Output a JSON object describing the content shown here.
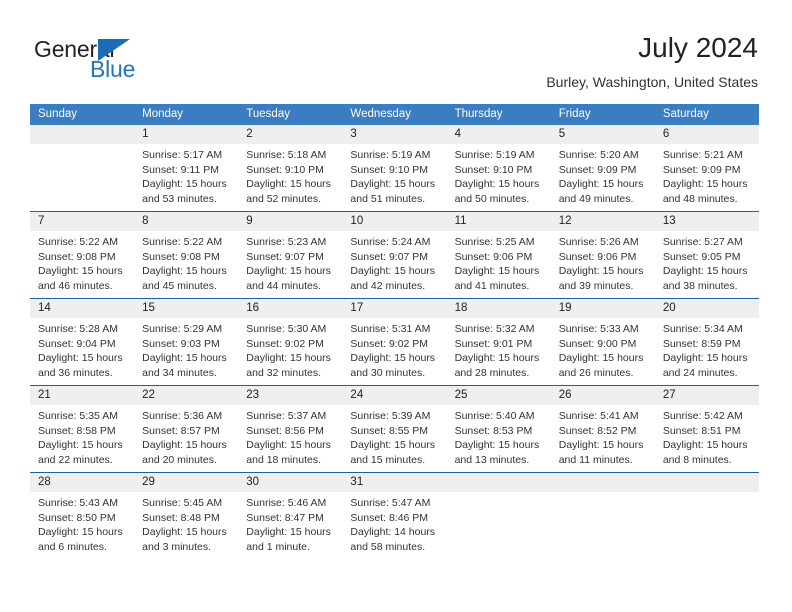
{
  "brand": {
    "name_top": "General",
    "name_bottom": "Blue",
    "accent_color": "#1b6cb5"
  },
  "header": {
    "title": "July 2024",
    "location": "Burley, Washington, United States"
  },
  "calendar": {
    "header_bg": "#3a7dc0",
    "row_border_color": "#1f5fa8",
    "daynum_bg": "#efefef",
    "weekdays": [
      "Sunday",
      "Monday",
      "Tuesday",
      "Wednesday",
      "Thursday",
      "Friday",
      "Saturday"
    ],
    "weeks": [
      [
        {
          "day": "",
          "lines": []
        },
        {
          "day": "1",
          "lines": [
            "Sunrise: 5:17 AM",
            "Sunset: 9:11 PM",
            "Daylight: 15 hours",
            "and 53 minutes."
          ]
        },
        {
          "day": "2",
          "lines": [
            "Sunrise: 5:18 AM",
            "Sunset: 9:10 PM",
            "Daylight: 15 hours",
            "and 52 minutes."
          ]
        },
        {
          "day": "3",
          "lines": [
            "Sunrise: 5:19 AM",
            "Sunset: 9:10 PM",
            "Daylight: 15 hours",
            "and 51 minutes."
          ]
        },
        {
          "day": "4",
          "lines": [
            "Sunrise: 5:19 AM",
            "Sunset: 9:10 PM",
            "Daylight: 15 hours",
            "and 50 minutes."
          ]
        },
        {
          "day": "5",
          "lines": [
            "Sunrise: 5:20 AM",
            "Sunset: 9:09 PM",
            "Daylight: 15 hours",
            "and 49 minutes."
          ]
        },
        {
          "day": "6",
          "lines": [
            "Sunrise: 5:21 AM",
            "Sunset: 9:09 PM",
            "Daylight: 15 hours",
            "and 48 minutes."
          ]
        }
      ],
      [
        {
          "day": "7",
          "lines": [
            "Sunrise: 5:22 AM",
            "Sunset: 9:08 PM",
            "Daylight: 15 hours",
            "and 46 minutes."
          ]
        },
        {
          "day": "8",
          "lines": [
            "Sunrise: 5:22 AM",
            "Sunset: 9:08 PM",
            "Daylight: 15 hours",
            "and 45 minutes."
          ]
        },
        {
          "day": "9",
          "lines": [
            "Sunrise: 5:23 AM",
            "Sunset: 9:07 PM",
            "Daylight: 15 hours",
            "and 44 minutes."
          ]
        },
        {
          "day": "10",
          "lines": [
            "Sunrise: 5:24 AM",
            "Sunset: 9:07 PM",
            "Daylight: 15 hours",
            "and 42 minutes."
          ]
        },
        {
          "day": "11",
          "lines": [
            "Sunrise: 5:25 AM",
            "Sunset: 9:06 PM",
            "Daylight: 15 hours",
            "and 41 minutes."
          ]
        },
        {
          "day": "12",
          "lines": [
            "Sunrise: 5:26 AM",
            "Sunset: 9:06 PM",
            "Daylight: 15 hours",
            "and 39 minutes."
          ]
        },
        {
          "day": "13",
          "lines": [
            "Sunrise: 5:27 AM",
            "Sunset: 9:05 PM",
            "Daylight: 15 hours",
            "and 38 minutes."
          ]
        }
      ],
      [
        {
          "day": "14",
          "lines": [
            "Sunrise: 5:28 AM",
            "Sunset: 9:04 PM",
            "Daylight: 15 hours",
            "and 36 minutes."
          ]
        },
        {
          "day": "15",
          "lines": [
            "Sunrise: 5:29 AM",
            "Sunset: 9:03 PM",
            "Daylight: 15 hours",
            "and 34 minutes."
          ]
        },
        {
          "day": "16",
          "lines": [
            "Sunrise: 5:30 AM",
            "Sunset: 9:02 PM",
            "Daylight: 15 hours",
            "and 32 minutes."
          ]
        },
        {
          "day": "17",
          "lines": [
            "Sunrise: 5:31 AM",
            "Sunset: 9:02 PM",
            "Daylight: 15 hours",
            "and 30 minutes."
          ]
        },
        {
          "day": "18",
          "lines": [
            "Sunrise: 5:32 AM",
            "Sunset: 9:01 PM",
            "Daylight: 15 hours",
            "and 28 minutes."
          ]
        },
        {
          "day": "19",
          "lines": [
            "Sunrise: 5:33 AM",
            "Sunset: 9:00 PM",
            "Daylight: 15 hours",
            "and 26 minutes."
          ]
        },
        {
          "day": "20",
          "lines": [
            "Sunrise: 5:34 AM",
            "Sunset: 8:59 PM",
            "Daylight: 15 hours",
            "and 24 minutes."
          ]
        }
      ],
      [
        {
          "day": "21",
          "lines": [
            "Sunrise: 5:35 AM",
            "Sunset: 8:58 PM",
            "Daylight: 15 hours",
            "and 22 minutes."
          ]
        },
        {
          "day": "22",
          "lines": [
            "Sunrise: 5:36 AM",
            "Sunset: 8:57 PM",
            "Daylight: 15 hours",
            "and 20 minutes."
          ]
        },
        {
          "day": "23",
          "lines": [
            "Sunrise: 5:37 AM",
            "Sunset: 8:56 PM",
            "Daylight: 15 hours",
            "and 18 minutes."
          ]
        },
        {
          "day": "24",
          "lines": [
            "Sunrise: 5:39 AM",
            "Sunset: 8:55 PM",
            "Daylight: 15 hours",
            "and 15 minutes."
          ]
        },
        {
          "day": "25",
          "lines": [
            "Sunrise: 5:40 AM",
            "Sunset: 8:53 PM",
            "Daylight: 15 hours",
            "and 13 minutes."
          ]
        },
        {
          "day": "26",
          "lines": [
            "Sunrise: 5:41 AM",
            "Sunset: 8:52 PM",
            "Daylight: 15 hours",
            "and 11 minutes."
          ]
        },
        {
          "day": "27",
          "lines": [
            "Sunrise: 5:42 AM",
            "Sunset: 8:51 PM",
            "Daylight: 15 hours",
            "and 8 minutes."
          ]
        }
      ],
      [
        {
          "day": "28",
          "lines": [
            "Sunrise: 5:43 AM",
            "Sunset: 8:50 PM",
            "Daylight: 15 hours",
            "and 6 minutes."
          ]
        },
        {
          "day": "29",
          "lines": [
            "Sunrise: 5:45 AM",
            "Sunset: 8:48 PM",
            "Daylight: 15 hours",
            "and 3 minutes."
          ]
        },
        {
          "day": "30",
          "lines": [
            "Sunrise: 5:46 AM",
            "Sunset: 8:47 PM",
            "Daylight: 15 hours",
            "and 1 minute."
          ]
        },
        {
          "day": "31",
          "lines": [
            "Sunrise: 5:47 AM",
            "Sunset: 8:46 PM",
            "Daylight: 14 hours",
            "and 58 minutes."
          ]
        },
        {
          "day": "",
          "lines": []
        },
        {
          "day": "",
          "lines": []
        },
        {
          "day": "",
          "lines": []
        }
      ]
    ]
  }
}
